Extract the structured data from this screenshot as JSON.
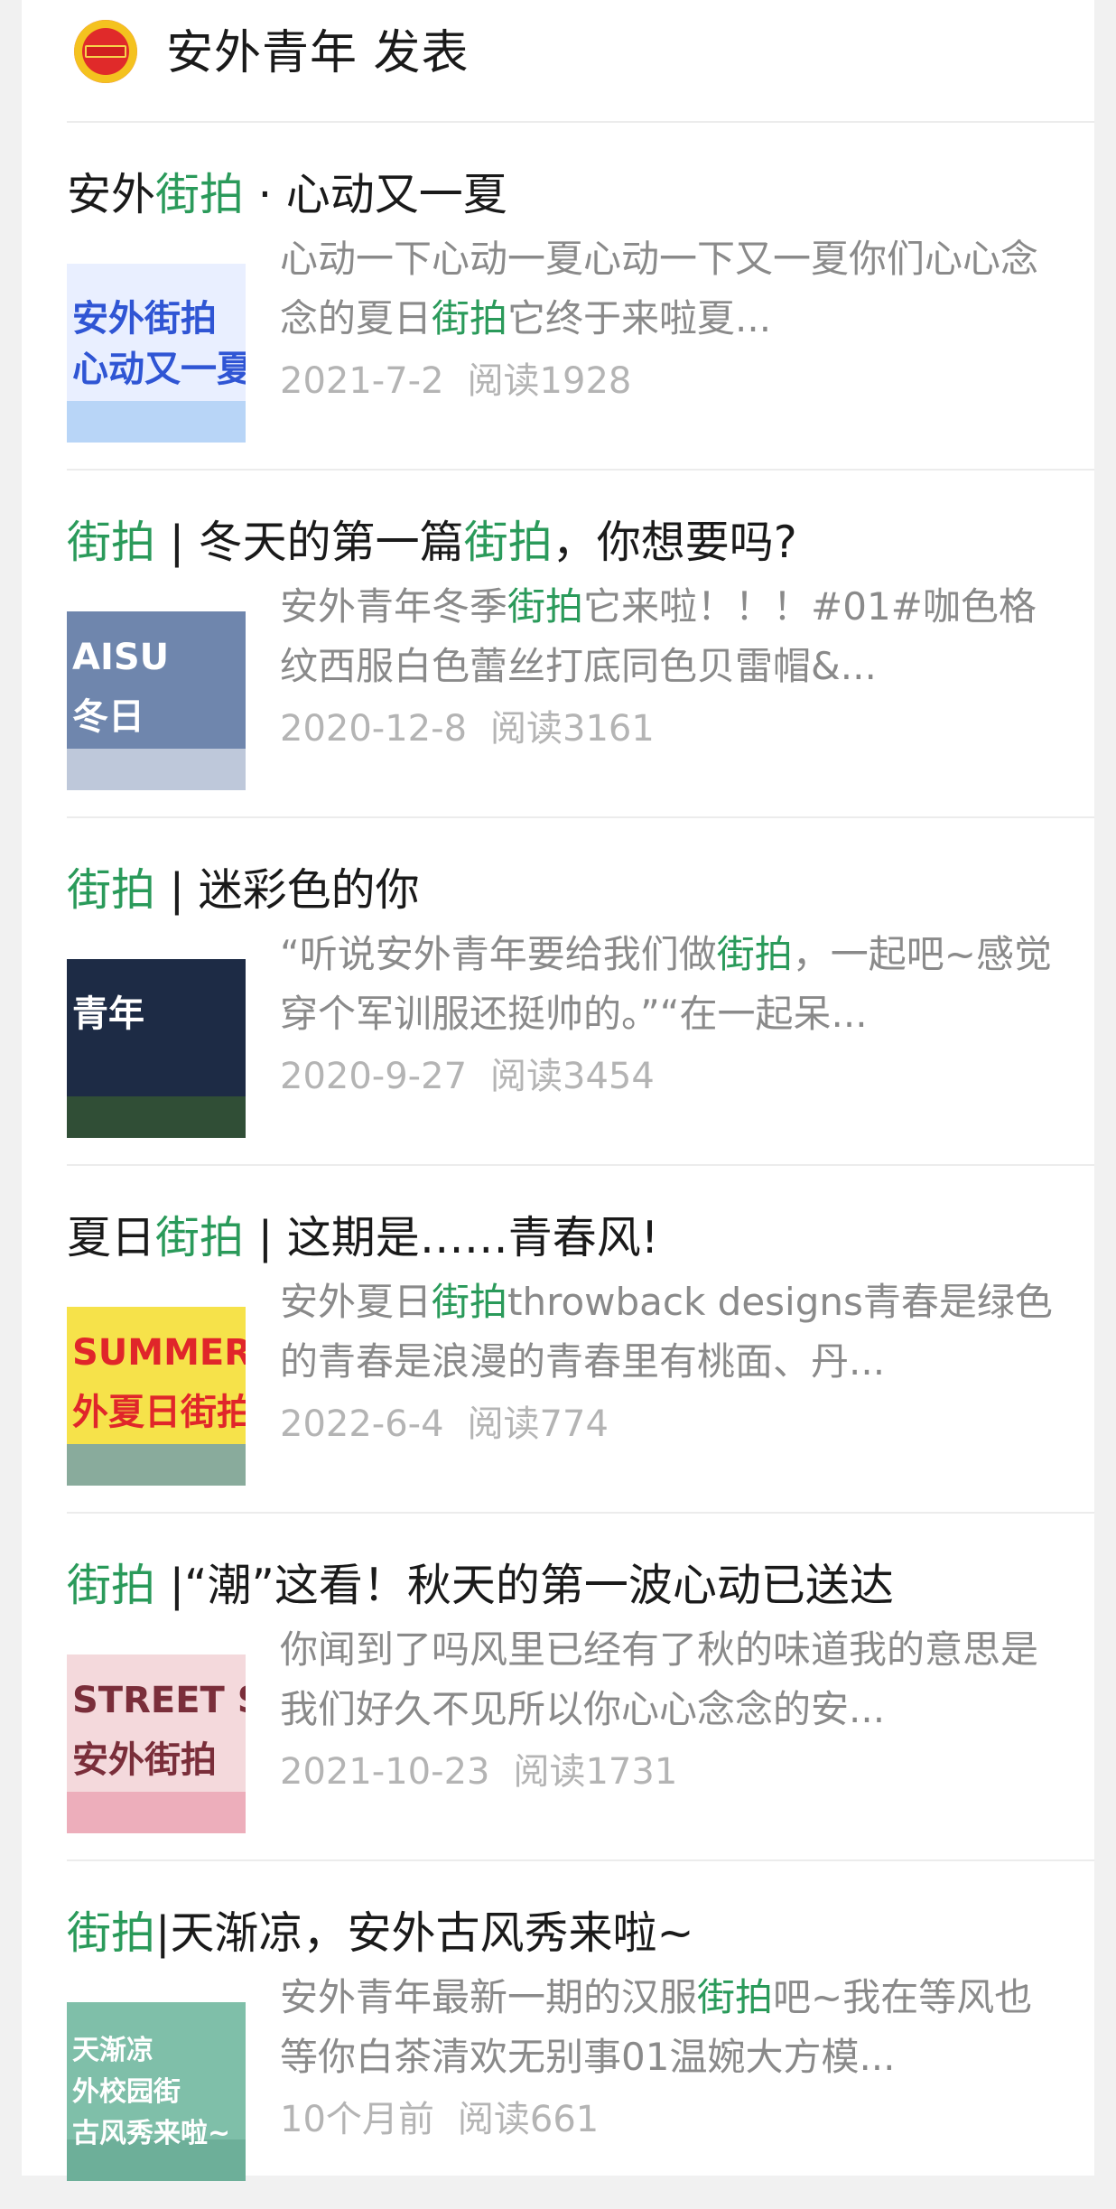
{
  "header": {
    "account_title": "安外青年 发表"
  },
  "articles": [
    {
      "title_parts": [
        {
          "text": "安外",
          "hl": false
        },
        {
          "text": "街拍",
          "hl": true
        },
        {
          "text": " · 心动又一夏",
          "hl": false
        }
      ],
      "summary_parts": [
        {
          "text": "心动一下心动一夏心动一下又一夏你们心心念念的夏日",
          "hl": false
        },
        {
          "text": "街拍",
          "hl": true
        },
        {
          "text": "它终于来啦夏...",
          "hl": false
        }
      ],
      "date": "2021-7-2",
      "reads": "阅读1928",
      "thumb": {
        "text": "安外街拍\n心动又一夏",
        "bg": "#e9efff",
        "fg": "#2f55d4",
        "accent": "#8fbff0"
      }
    },
    {
      "title_parts": [
        {
          "text": "街拍",
          "hl": true
        },
        {
          "text": " | 冬天的第一篇",
          "hl": false
        },
        {
          "text": "街拍",
          "hl": true
        },
        {
          "text": "，你想要吗?",
          "hl": false
        }
      ],
      "summary_parts": [
        {
          "text": "安外青年冬季",
          "hl": false
        },
        {
          "text": "街拍",
          "hl": true
        },
        {
          "text": "它来啦！！！#01#咖色格纹西服白色蕾丝打底同色贝雷帽&...",
          "hl": false
        }
      ],
      "date": "2020-12-8",
      "reads": "阅读3161",
      "thumb": {
        "text": "AISU\n冬日",
        "bg": "#6f86ad",
        "fg": "#ffffff",
        "accent": "#ffffff"
      }
    },
    {
      "title_parts": [
        {
          "text": "街拍",
          "hl": true
        },
        {
          "text": " | 迷彩色的你",
          "hl": false
        }
      ],
      "summary_parts": [
        {
          "text": "“听说安外青年要给我们做",
          "hl": false
        },
        {
          "text": "街拍",
          "hl": true
        },
        {
          "text": "，一起吧~感觉穿个军训服还挺帅的。”“在一起呆...",
          "hl": false
        }
      ],
      "date": "2020-9-27",
      "reads": "阅读3454",
      "thumb": {
        "text": "青年",
        "bg": "#1d2b45",
        "fg": "#ffffff",
        "accent": "#3f6b2a"
      }
    },
    {
      "title_parts": [
        {
          "text": "夏日",
          "hl": false
        },
        {
          "text": "街拍",
          "hl": true
        },
        {
          "text": " | 这期是……青春风!",
          "hl": false
        }
      ],
      "summary_parts": [
        {
          "text": "安外夏日",
          "hl": false
        },
        {
          "text": "街拍",
          "hl": true
        },
        {
          "text": "throwback designs青春是绿色的青春是浪漫的青春里有桃面、丹...",
          "hl": false
        }
      ],
      "date": "2022-6-4",
      "reads": "阅读774",
      "thumb": {
        "text": "SUMMER NEW\n外夏日街拍",
        "bg": "#f6e24a",
        "fg": "#e0262a",
        "accent": "#2f7de0"
      }
    },
    {
      "title_parts": [
        {
          "text": "街拍",
          "hl": true
        },
        {
          "text": " |“潮”这看！秋天的第一波心动已送达",
          "hl": false
        }
      ],
      "summary_parts": [
        {
          "text": "你闻到了吗风里已经有了秋的味道我的意思是我们好久不见所以你心心念念的安...",
          "hl": false
        }
      ],
      "date": "2021-10-23",
      "reads": "阅读1731",
      "thumb": {
        "text": "STREET S\n安外街拍",
        "bg": "#f4d9dc",
        "fg": "#7a2e3a",
        "accent": "#e88aa0"
      }
    },
    {
      "title_parts": [
        {
          "text": "街拍",
          "hl": true
        },
        {
          "text": "|天渐凉，安外古风秀来啦~",
          "hl": false
        }
      ],
      "summary_parts": [
        {
          "text": "安外青年最新一期的汉服",
          "hl": false
        },
        {
          "text": "街拍",
          "hl": true
        },
        {
          "text": "吧~我在等风也等你白茶清欢无别事01温婉大方模...",
          "hl": false
        }
      ],
      "date": "10个月前",
      "reads": "阅读661",
      "thumb": {
        "text": "天渐凉\n外校园街\n古风秀来啦~",
        "bg": "#7fbfa9",
        "fg": "#ffffff",
        "accent": "#5fa38c"
      }
    }
  ]
}
